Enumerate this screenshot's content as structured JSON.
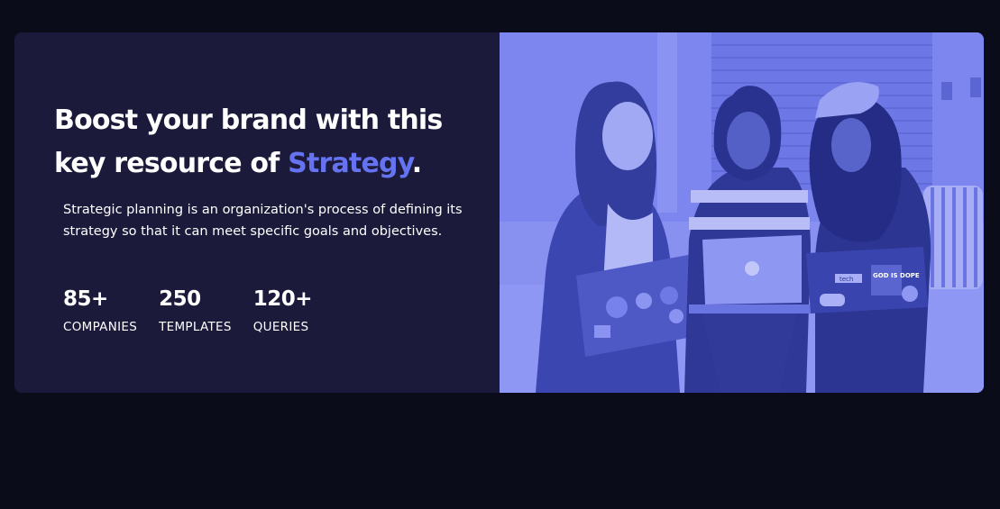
{
  "hero": {
    "headline_prefix": "Boost your brand with this key resource of ",
    "headline_accent": "Strategy",
    "headline_suffix": ".",
    "description": "Strategic planning is an organization's process of defining its strategy so that it can meet specific goals and objectives.",
    "stats": [
      {
        "value": "85+",
        "label": "COMPANIES"
      },
      {
        "value": "250",
        "label": "TEMPLATES"
      },
      {
        "value": "120+",
        "label": "QUERIES"
      }
    ]
  },
  "photo": {
    "subject": "three-women-with-laptops-photo",
    "tint_color": "#7c86ee",
    "sticker_texts": [
      "tech",
      "GOD IS DOPE"
    ]
  },
  "colors": {
    "background": "#0b0c1a",
    "card": "#1b1a3a",
    "accent": "#6673f0"
  }
}
